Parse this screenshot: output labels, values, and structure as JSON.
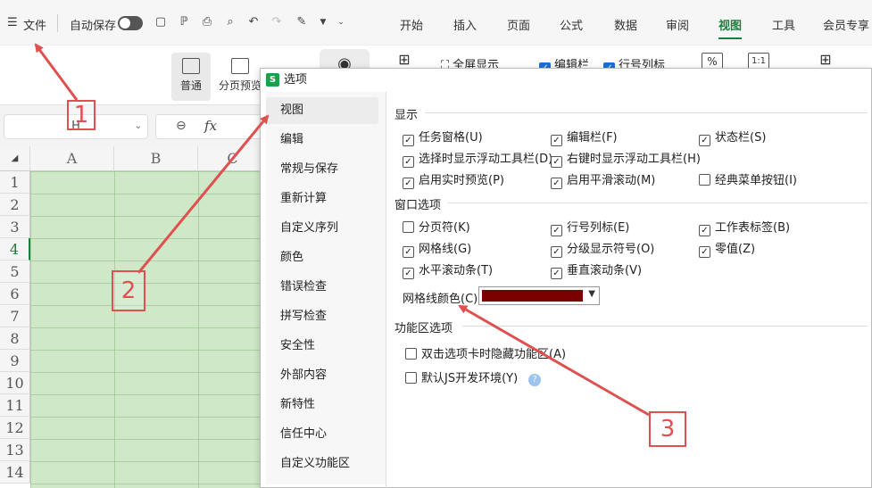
{
  "menubar": {
    "menu_icon": "☰",
    "file_label": "文件",
    "autosave_label": "自动保存",
    "tabs": [
      {
        "label": "开始"
      },
      {
        "label": "插入"
      },
      {
        "label": "页面"
      },
      {
        "label": "公式"
      },
      {
        "label": "数据"
      },
      {
        "label": "审阅"
      },
      {
        "label": "视图",
        "active": true
      },
      {
        "label": "工具"
      },
      {
        "label": "会员专享"
      }
    ],
    "quick_icons": [
      "save-icon",
      "format-painter-icon",
      "print-icon",
      "print-preview-icon",
      "undo-icon",
      "redo-icon",
      "highlight-icon",
      "more-icon"
    ]
  },
  "ribbon": {
    "normal_label": "普通",
    "page_break_label": "分页预览",
    "fullscreen_label": "全屏显示",
    "edit_bar_label": "编辑栏",
    "row_col_label": "行号列标",
    "zoom_ratio_label": "1:1"
  },
  "formula_bar": {
    "name_box": "H",
    "fx": "fx"
  },
  "sheet": {
    "columns": [
      "A",
      "B",
      "C"
    ],
    "rows": [
      "1",
      "2",
      "3",
      "4",
      "5",
      "6",
      "7",
      "8",
      "9",
      "10",
      "11",
      "12",
      "13",
      "14"
    ],
    "active_row": "4",
    "grid_fill_color": "#cfe8c8"
  },
  "dialog": {
    "title": "选项",
    "logo": "S",
    "sidebar": [
      {
        "label": "视图",
        "selected": true
      },
      {
        "label": "编辑"
      },
      {
        "label": "常规与保存"
      },
      {
        "label": "重新计算"
      },
      {
        "label": "自定义序列"
      },
      {
        "label": "颜色"
      },
      {
        "label": "错误检查"
      },
      {
        "label": "拼写检查"
      },
      {
        "label": "安全性"
      },
      {
        "label": "外部内容"
      },
      {
        "label": "新特性"
      },
      {
        "label": "信任中心"
      },
      {
        "label": "自定义功能区"
      }
    ],
    "display": {
      "title": "显示",
      "options": [
        {
          "label": "任务窗格(U)",
          "checked": true
        },
        {
          "label": "编辑栏(F)",
          "checked": true
        },
        {
          "label": "状态栏(S)",
          "checked": true
        },
        {
          "label": "选择时显示浮动工具栏(D)",
          "checked": true
        },
        {
          "label": "右键时显示浮动工具栏(H)",
          "checked": true
        },
        {
          "label": "启用实时预览(P)",
          "checked": true
        },
        {
          "label": "启用平滑滚动(M)",
          "checked": true
        },
        {
          "label": "经典菜单按钮(I)",
          "checked": false
        }
      ]
    },
    "window": {
      "title": "窗口选项",
      "options": [
        {
          "label": "分页符(K)",
          "checked": false
        },
        {
          "label": "行号列标(E)",
          "checked": true
        },
        {
          "label": "工作表标签(B)",
          "checked": true
        },
        {
          "label": "网格线(G)",
          "checked": true
        },
        {
          "label": "分级显示符号(O)",
          "checked": true
        },
        {
          "label": "零值(Z)",
          "checked": true
        },
        {
          "label": "水平滚动条(T)",
          "checked": true
        },
        {
          "label": "垂直滚动条(V)",
          "checked": true
        }
      ],
      "grid_color_label": "网格线颜色(C):",
      "grid_color": "#7b0000"
    },
    "ribbon_section": {
      "title": "功能区选项",
      "options": [
        {
          "label": "双击选项卡时隐藏功能区(A)",
          "checked": false
        },
        {
          "label": "默认JS开发环境(Y)",
          "checked": false
        }
      ]
    }
  },
  "annotations": [
    "1",
    "2",
    "3"
  ],
  "annotation_color": "#e05050"
}
